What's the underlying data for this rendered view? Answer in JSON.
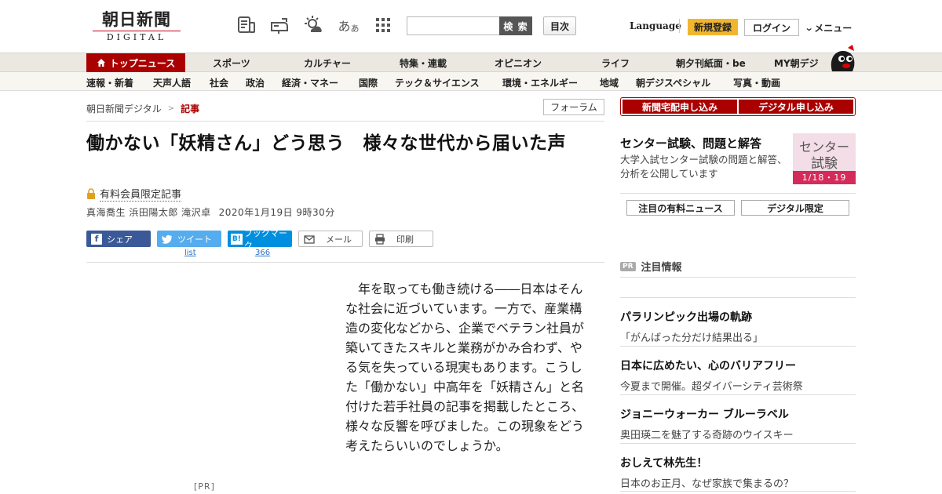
{
  "header": {
    "logo_main": "朝日新聞",
    "logo_sub": "DIGITAL",
    "search_placeholder": "",
    "search_button": "検 索",
    "toc_button": "目次",
    "language": "Language",
    "signup": "新規登録",
    "login": "ログイン",
    "menu": "メニュー",
    "icons": [
      "paper-icon",
      "mailbox-icon",
      "weather-icon",
      "font-size-icon",
      "grid-icon"
    ],
    "font_size_glyph": "あ",
    "font_size_glyph_small": "あ"
  },
  "nav_primary": [
    "トップニュース",
    "スポーツ",
    "カルチャー",
    "特集・連載",
    "オピニオン",
    "ライフ",
    "朝夕刊紙面・be",
    "MY朝デジ"
  ],
  "nav_secondary": [
    "速報・新着",
    "天声人語",
    "社会",
    "政治",
    "経済・マネー",
    "国際",
    "テック＆サイエンス",
    "環境・エネルギー",
    "地域",
    "朝デジスペシャル",
    "写真・動画"
  ],
  "breadcrumb": {
    "root": "朝日新聞デジタル",
    "sep": ">",
    "current": "記事"
  },
  "forum_button": "フォーラム",
  "article": {
    "title": "働かない「妖精さん」どう思う　様々な世代から届いた声",
    "paid_label": "有料会員限定記事",
    "authors": "真海喬生 浜田陽太郎 滝沢卓",
    "date": "2020年1月19日 9時30分",
    "body": "年を取っても働き続ける――日本はそんな社会に近づいています。一方で、産業構造の変化などから、企業でベテラン社員が築いてきたスキルと業務がかみ合わず、やる気を失っている現実もあります。こうした「働かない」中高年を「妖精さん」と名付けた若手社員の記事を掲載したところ、様々な反響を呼びました。この現象をどう考えたらいいのでしょうか。",
    "pr_tag": "[PR]"
  },
  "share": {
    "facebook": "シェア",
    "twitter": "ツイート",
    "hatena": "ブックマーク",
    "hatena_icon": "B!",
    "mail": "メール",
    "print": "印刷",
    "twitter_count": "list",
    "hatena_count": "366"
  },
  "sidebar": {
    "apply_home": "新聞宅配申し込み",
    "apply_digital": "デジタル申し込み",
    "center_title": "センター試験、問題と解答",
    "center_desc": "大学入試センター試験の問題と解答、分析を公開しています",
    "center_banner_1": "センター",
    "center_banner_2": "試験",
    "center_banner_3": "1/18・19",
    "tab_paid": "注目の有料ニュース",
    "tab_digital": "デジタル限定",
    "pr_badge": "PR",
    "pr_label": "注目情報",
    "pr_items": [
      {
        "h": "パラリンピック出場の軌跡",
        "s": "「がんばった分だけ結果出る」"
      },
      {
        "h": "日本に広めたい、心のバリアフリー",
        "s": "今夏まで開催。超ダイバーシティ芸術祭"
      },
      {
        "h": "ジョニーウォーカー ブルーラベル",
        "s": "奥田瑛二を魅了する奇跡のウイスキー"
      },
      {
        "h": "おしえて林先生！",
        "s": "日本のお正月、なぜ家族で集まるの？"
      }
    ]
  },
  "colors": {
    "brand_red": "#aa0000",
    "signup_yellow": "#f0b62d",
    "facebook": "#3b5998",
    "twitter": "#55acee",
    "hatena": "#008fde"
  }
}
